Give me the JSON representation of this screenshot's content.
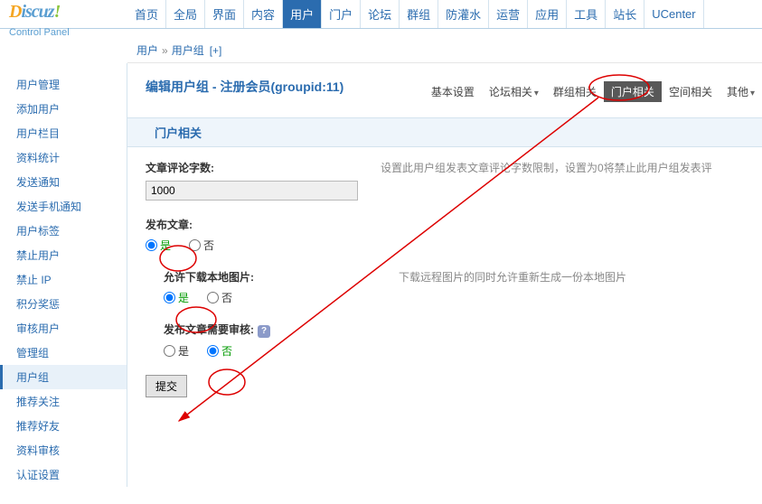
{
  "logo": {
    "d": "D",
    "rest": "iscuz",
    "bang": "!",
    "subtitle": "Control Panel"
  },
  "topnav": [
    "首页",
    "全局",
    "界面",
    "内容",
    "用户",
    "门户",
    "论坛",
    "群组",
    "防灌水",
    "运营",
    "应用",
    "工具",
    "站长",
    "UCenter"
  ],
  "topnav_active": 4,
  "breadcrumb": {
    "a": "用户",
    "b": "用户组",
    "add": "[+]"
  },
  "sidebar": [
    "用户管理",
    "添加用户",
    "用户栏目",
    "资料统计",
    "发送通知",
    "发送手机通知",
    "用户标签",
    "禁止用户",
    "禁止 IP",
    "积分奖惩",
    "审核用户",
    "管理组",
    "用户组",
    "推荐关注",
    "推荐好友",
    "资料审核",
    "认证设置"
  ],
  "sidebar_active": 12,
  "page_title_prefix": "编辑用户组 - ",
  "page_title_group": "注册会员(groupid:11)",
  "tabs": [
    {
      "label": "基本设置",
      "caret": false
    },
    {
      "label": "论坛相关",
      "caret": true
    },
    {
      "label": "群组相关",
      "caret": false
    },
    {
      "label": "门户相关",
      "caret": false
    },
    {
      "label": "空间相关",
      "caret": false
    },
    {
      "label": "其他",
      "caret": true
    }
  ],
  "tabs_active": 3,
  "section_title": "门户相关",
  "fields": {
    "comment_chars": {
      "label": "文章评论字数:",
      "value": "1000",
      "hint": "设置此用户组发表文章评论字数限制，设置为0将禁止此用户组发表评"
    },
    "publish": {
      "label": "发布文章:",
      "yes": "是",
      "no": "否",
      "value": "yes"
    },
    "download_local": {
      "label": "允许下载本地图片:",
      "yes": "是",
      "no": "否",
      "value": "yes",
      "hint": "下载远程图片的同时允许重新生成一份本地图片"
    },
    "need_review": {
      "label": "发布文章需要审核:",
      "yes": "是",
      "no": "否",
      "value": "no"
    }
  },
  "submit_label": "提交"
}
